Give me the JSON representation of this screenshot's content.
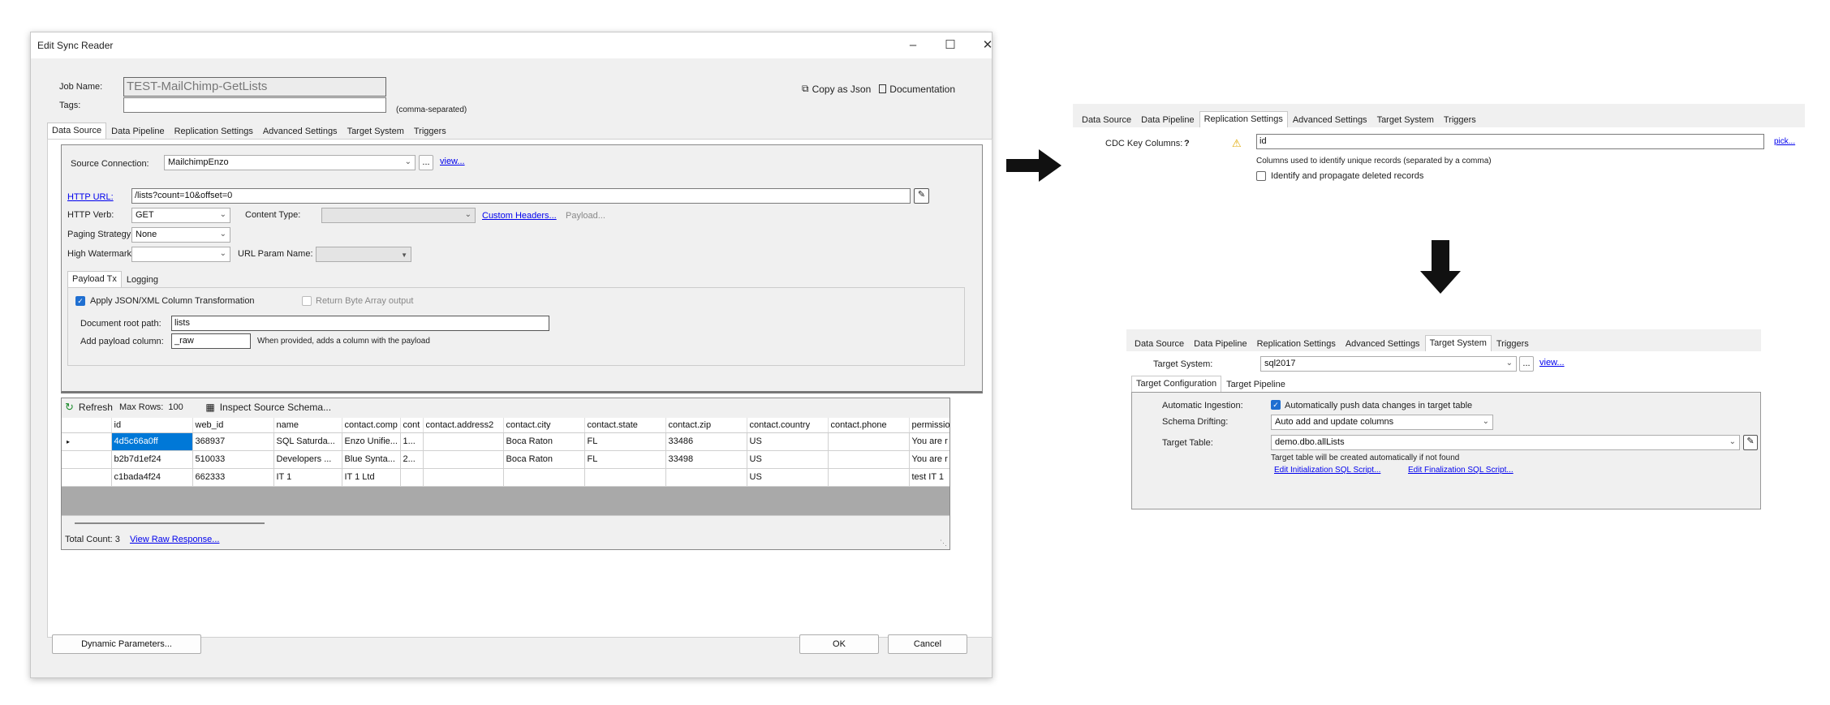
{
  "window": {
    "title": "Edit Sync Reader"
  },
  "header": {
    "job_name_label": "Job Name:",
    "job_name_value": "TEST-MailChimp-GetLists",
    "tags_label": "Tags:",
    "tags_value": "",
    "tags_hint": "(comma-separated)",
    "copy_json_label": "Copy as Json",
    "documentation_label": "Documentation"
  },
  "tabs": [
    "Data Source",
    "Data Pipeline",
    "Replication Settings",
    "Advanced Settings",
    "Target System",
    "Triggers"
  ],
  "datasource": {
    "source_connection_label": "Source Connection:",
    "source_connection_value": "MailchimpEnzo",
    "ellipsis": "...",
    "view_link": "view...",
    "http_url_label": "HTTP URL:",
    "http_url_value": "/lists?count=10&offset=0",
    "http_verb_label": "HTTP Verb:",
    "http_verb_value": "GET",
    "content_type_label": "Content Type:",
    "content_type_value": "",
    "custom_headers_link": "Custom Headers...",
    "payload_link": "Payload...",
    "paging_label": "Paging Strategy:",
    "paging_value": "None",
    "high_watermark_label": "High Watermark:",
    "high_watermark_value": "",
    "url_param_label": "URL Param Name:",
    "url_param_value": "",
    "subtabs": [
      "Payload Tx",
      "Logging"
    ],
    "apply_json_label": "Apply JSON/XML Column Transformation",
    "apply_json_checked": true,
    "return_byte_label": "Return Byte Array output",
    "return_byte_checked": false,
    "doc_root_label": "Document root path:",
    "doc_root_value": "lists",
    "add_payload_label": "Add payload column:",
    "add_payload_value": "_raw",
    "add_payload_hint": "When provided, adds a column with the payload"
  },
  "results": {
    "refresh_label": "Refresh",
    "max_rows_label": "Max Rows:",
    "max_rows_value": "100",
    "inspect_label": "Inspect Source Schema...",
    "columns": [
      "",
      "id",
      "web_id",
      "name",
      "contact.comp",
      "cont",
      "contact.address2",
      "contact.city",
      "contact.state",
      "contact.zip",
      "contact.country",
      "contact.phone",
      "permissio"
    ],
    "rows": [
      [
        "▸",
        "4d5c66a0ff",
        "368937",
        "SQL Saturda...",
        "Enzo Unifie...",
        "1...",
        "",
        "Boca Raton",
        "FL",
        "33486",
        "US",
        "",
        "You are r"
      ],
      [
        "",
        "b2b7d1ef24",
        "510033",
        "Developers ...",
        "Blue Synta...",
        "2...",
        "",
        "Boca Raton",
        "FL",
        "33498",
        "US",
        "",
        "You are r"
      ],
      [
        "",
        "c1bada4f24",
        "662333",
        "IT 1",
        "IT 1 Ltd",
        "",
        "",
        "",
        "",
        "",
        "US",
        "",
        "test IT 1"
      ]
    ],
    "total_count_label": "Total Count: 3",
    "raw_response_link": "View Raw Response..."
  },
  "footer": {
    "dynamic_params_label": "Dynamic Parameters...",
    "ok_label": "OK",
    "cancel_label": "Cancel"
  },
  "replication_panel": {
    "tabs": [
      "Data Source",
      "Data Pipeline",
      "Replication Settings",
      "Advanced Settings",
      "Target System",
      "Triggers"
    ],
    "cdc_label": "CDC Key Columns:",
    "help_mark": "?",
    "cdc_value": "id",
    "pick_link": "pick...",
    "cdc_hint": "Columns used to identify unique records (separated by a comma)",
    "deleted_label": "Identify and propagate deleted records",
    "deleted_checked": false
  },
  "target_panel": {
    "tabs": [
      "Data Source",
      "Data Pipeline",
      "Replication Settings",
      "Advanced Settings",
      "Target System",
      "Triggers"
    ],
    "target_system_label": "Target System:",
    "target_system_value": "sql2017",
    "ellipsis": "...",
    "view_link": "view...",
    "subtabs": [
      "Target Configuration",
      "Target Pipeline"
    ],
    "auto_ingest_label": "Automatic Ingestion:",
    "auto_ingest_text": "Automatically push data changes in target table",
    "auto_ingest_checked": true,
    "schema_drift_label": "Schema Drifting:",
    "schema_drift_value": "Auto add and update columns",
    "target_table_label": "Target Table:",
    "target_table_value": "demo.dbo.allLists",
    "target_table_hint": "Target table will be created automatically if not found",
    "init_sql_link": "Edit Initialization SQL Script...",
    "final_sql_link": "Edit Finalization SQL Script..."
  }
}
